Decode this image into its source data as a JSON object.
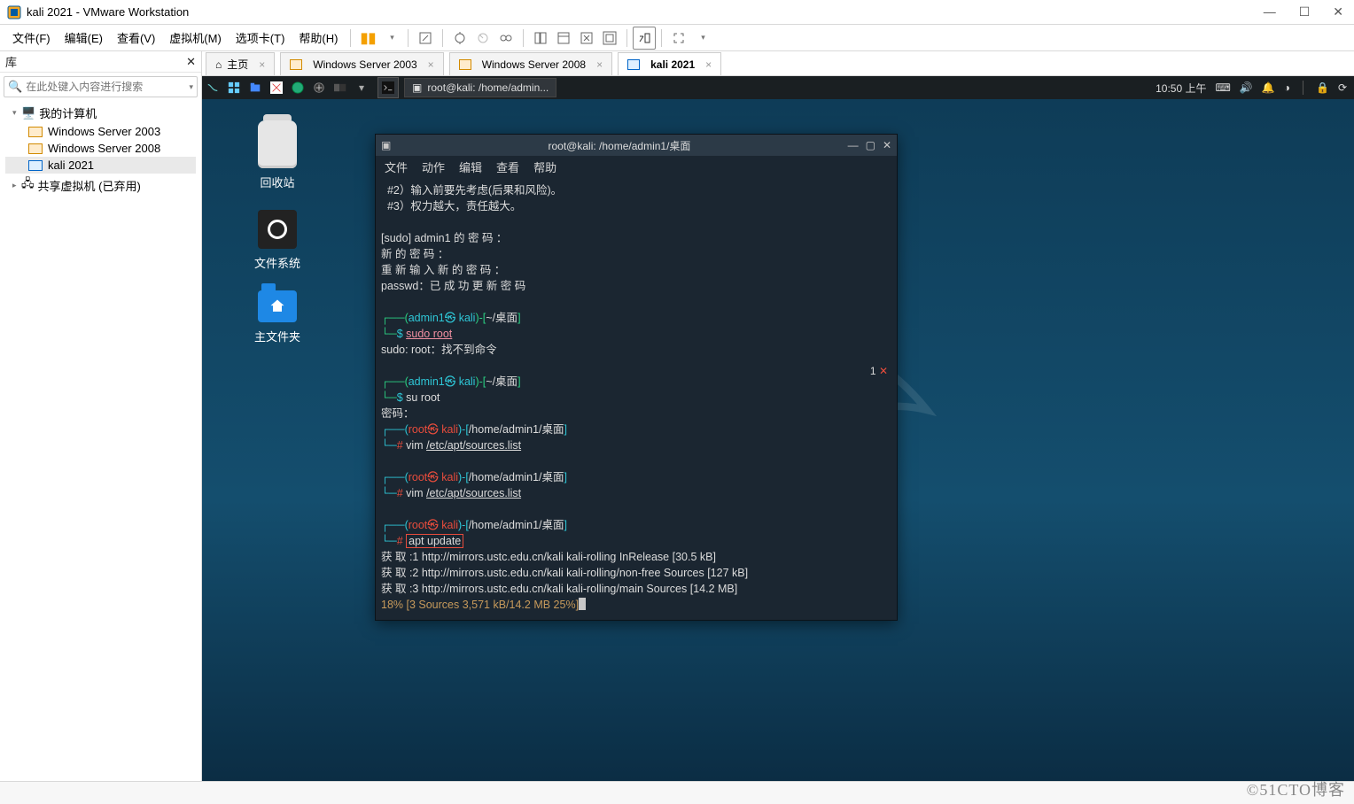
{
  "window": {
    "title": "kali 2021 - VMware Workstation"
  },
  "menu": {
    "file": "文件(F)",
    "edit": "编辑(E)",
    "view": "查看(V)",
    "vm": "虚拟机(M)",
    "tabs": "选项卡(T)",
    "help": "帮助(H)"
  },
  "library": {
    "header": "库",
    "search_placeholder": "在此处键入内容进行搜索",
    "root": "我的计算机",
    "vms": [
      "Windows Server 2003",
      "Windows Server 2008",
      "kali 2021"
    ],
    "shared": "共享虚拟机 (已弃用)"
  },
  "tabs": {
    "home": "主页",
    "items": [
      {
        "label": "Windows Server 2003"
      },
      {
        "label": "Windows Server 2008"
      },
      {
        "label": "kali 2021",
        "active": true
      }
    ]
  },
  "kali_panel": {
    "task": "root@kali: /home/admin...",
    "clock": "10:50 上午"
  },
  "desktop": {
    "trash": "回收站",
    "filesystem": "文件系统",
    "home": "主文件夹"
  },
  "terminal": {
    "title": "root@kali: /home/admin1/桌面",
    "menus": [
      "文件",
      "动作",
      "编辑",
      "查看",
      "帮助"
    ],
    "tip2": "  #2）输入前要先考虑(后果和风险)。",
    "tip3": "  #3）权力越大，责任越大。",
    "sudo_pw": "[sudo] admin1 的 密 码 ：",
    "new_pw": "新 的 密 码 ：",
    "rep_pw": "重 新 输 入 新 的 密 码 ：",
    "pw_ok": "passwd：已 成 功 更 新 密 码",
    "user_prompt_user": "admin1㉿ kali",
    "user_prompt_dir": "~/桌面",
    "root_prompt_user": "root㉿ kali",
    "root_prompt_dir": "/home/admin1/桌面",
    "cmd_sudo_root": "sudo root",
    "sudo_err": "sudo: root：找不到命令",
    "cmd_su_root": "su root",
    "pw_prompt": "密码：",
    "cmd_vim": "vim ",
    "sources_path": "/etc/apt/sources.list",
    "cmd_apt": "apt update",
    "apt_l1": "获 取 :1 http://mirrors.ustc.edu.cn/kali kali-rolling InRelease [30.5 kB]",
    "apt_l2": "获 取 :2 http://mirrors.ustc.edu.cn/kali kali-rolling/non-free Sources [127 kB]",
    "apt_l3": "获 取 :3 http://mirrors.ustc.edu.cn/kali kali-rolling/main Sources [14.2 MB]",
    "apt_prog": "18% [3 Sources 3,571 kB/14.2 MB 25%]",
    "err_badge": "1 ✕"
  },
  "watermark": "©51CTO博客"
}
